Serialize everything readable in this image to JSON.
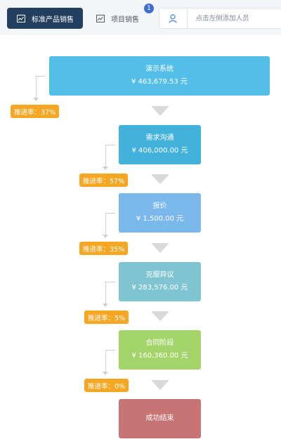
{
  "tabs": [
    {
      "label": "标准产品销售",
      "icon": "chart-window-icon"
    },
    {
      "label": "项目销售",
      "icon": "chart-window-icon"
    }
  ],
  "badge": "1",
  "user_picker": {
    "icon": "user-icon",
    "placeholder": "点击左侧添加人员"
  },
  "funnel": {
    "stages": [
      {
        "name": "演示系统",
        "amount": "¥ 463,679.53 元",
        "color": "#53bfe9"
      },
      {
        "name": "需求沟通",
        "amount": "¥ 406,000.00 元",
        "color": "#42b1dc"
      },
      {
        "name": "报价",
        "amount": "¥ 1,500.00 元",
        "color": "#7ab7ea"
      },
      {
        "name": "克服异议",
        "amount": "¥ 283,576.00 元",
        "color": "#7ec4d1"
      },
      {
        "name": "合同阶段",
        "amount": "¥ 160,360.00 元",
        "color": "#a3d46a"
      },
      {
        "name": "成功结束",
        "color": "#c97474"
      }
    ],
    "rates": [
      "推进率：37%",
      "推进率：57%",
      "推进率：35%",
      "推进率：5%",
      "推进率：0%"
    ],
    "rate_color": "#f5a623",
    "arrow_color": "#d9d9d9"
  }
}
